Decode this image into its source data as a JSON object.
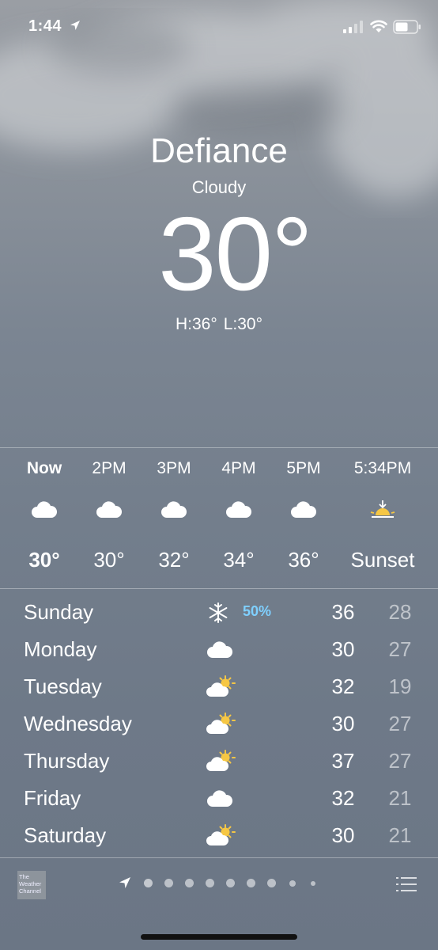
{
  "status_bar": {
    "time": "1:44",
    "location_icon": "location-arrow-icon",
    "signal_icon": "cellular-signal-icon",
    "wifi_icon": "wifi-icon",
    "battery_icon": "battery-icon"
  },
  "header": {
    "city": "Defiance",
    "condition": "Cloudy",
    "temperature": "30°",
    "high": "H:36°",
    "low": "L:30°"
  },
  "hourly": [
    {
      "time": "Now",
      "icon": "cloud-icon",
      "temp": "30°"
    },
    {
      "time": "2PM",
      "icon": "cloud-icon",
      "temp": "30°"
    },
    {
      "time": "3PM",
      "icon": "cloud-icon",
      "temp": "32°"
    },
    {
      "time": "4PM",
      "icon": "cloud-icon",
      "temp": "34°"
    },
    {
      "time": "5PM",
      "icon": "cloud-icon",
      "temp": "36°"
    },
    {
      "time": "5:34PM",
      "icon": "sunset-icon",
      "temp": "Sunset"
    }
  ],
  "daily": [
    {
      "day": "Sunday",
      "icon": "snowflake-icon",
      "precip": "50%",
      "high": "36",
      "low": "28"
    },
    {
      "day": "Monday",
      "icon": "cloud-icon",
      "precip": "",
      "high": "30",
      "low": "27"
    },
    {
      "day": "Tuesday",
      "icon": "partly-sunny-icon",
      "precip": "",
      "high": "32",
      "low": "19"
    },
    {
      "day": "Wednesday",
      "icon": "partly-sunny-icon",
      "precip": "",
      "high": "30",
      "low": "27"
    },
    {
      "day": "Thursday",
      "icon": "partly-sunny-icon",
      "precip": "",
      "high": "37",
      "low": "27"
    },
    {
      "day": "Friday",
      "icon": "cloud-icon",
      "precip": "",
      "high": "32",
      "low": "21"
    },
    {
      "day": "Saturday",
      "icon": "partly-sunny-icon",
      "precip": "",
      "high": "30",
      "low": "21"
    }
  ],
  "bottom_bar": {
    "logo_text": [
      "The",
      "Weather",
      "Channel"
    ],
    "page_dots": 9,
    "active_page": 0,
    "list_icon": "list-icon"
  },
  "colors": {
    "precip_text": "#7fd0ff",
    "sun": "#f6c744",
    "low_temp": "rgba(255,255,255,0.55)"
  }
}
